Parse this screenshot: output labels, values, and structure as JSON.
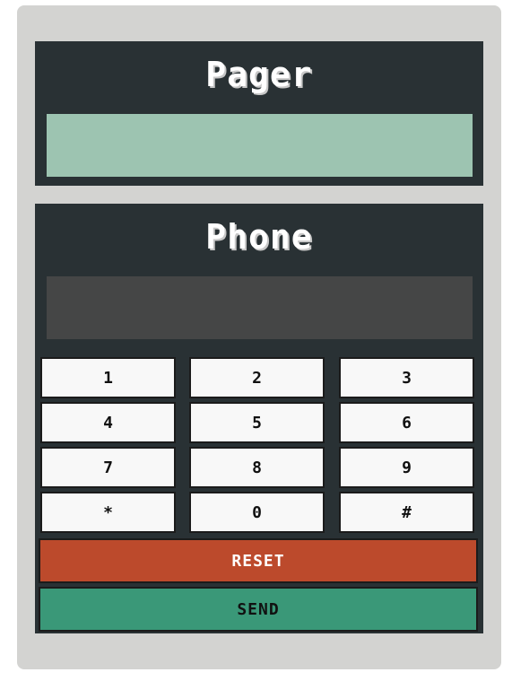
{
  "pager": {
    "title": "Pager",
    "display": ""
  },
  "phone": {
    "title": "Phone",
    "display": "",
    "keys": [
      "1",
      "2",
      "3",
      "4",
      "5",
      "6",
      "7",
      "8",
      "9",
      "*",
      "0",
      "#"
    ],
    "reset_label": "RESET",
    "send_label": "SEND"
  },
  "colors": {
    "background": "#d3d3d1",
    "panel": "#293134",
    "pager_screen": "#9dc4b1",
    "phone_screen": "#454646",
    "key": "#f8f8f8",
    "reset": "#bc4a2c",
    "send": "#3a9878"
  }
}
